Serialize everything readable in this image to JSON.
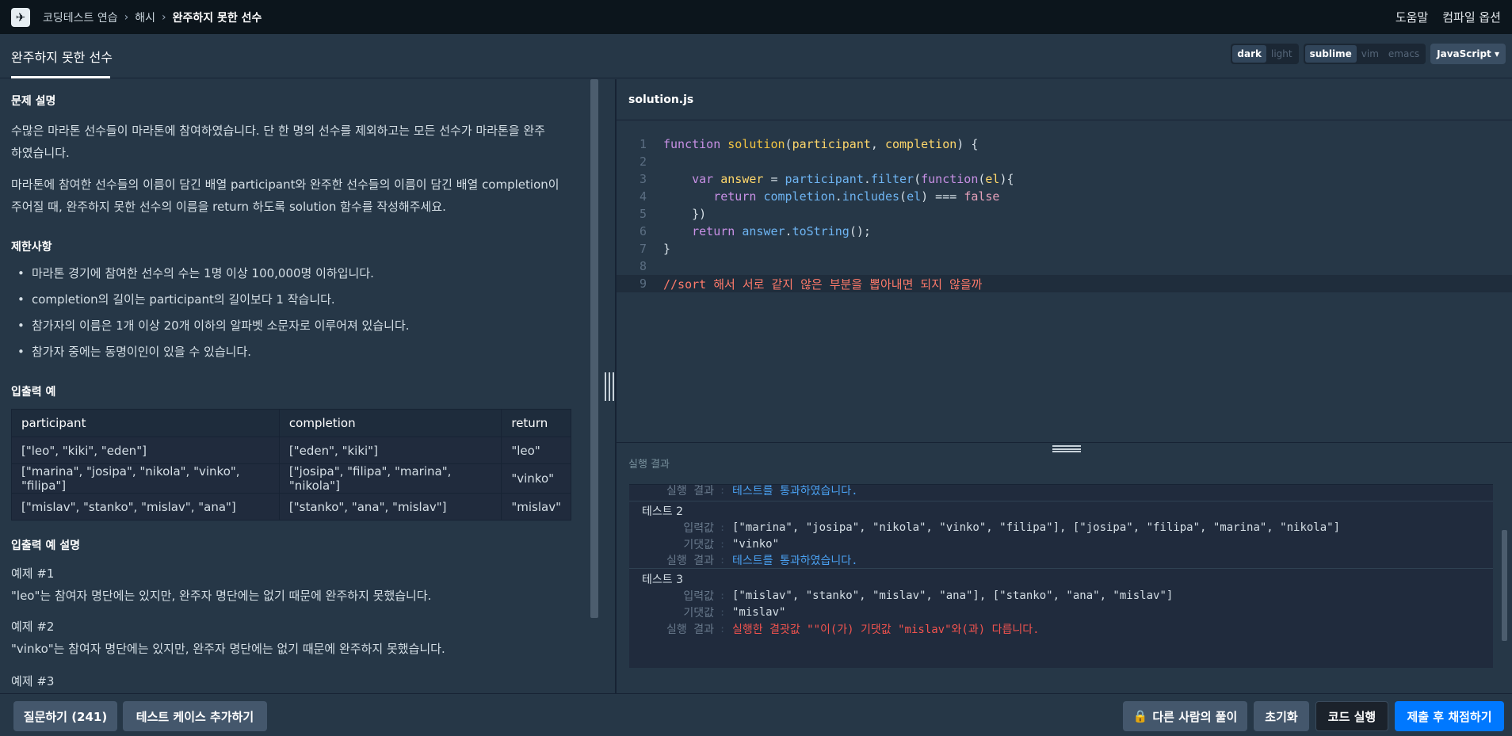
{
  "nav": {
    "crumbs": [
      "코딩테스트 연습",
      "해시",
      "완주하지 못한 선수"
    ],
    "help": "도움말",
    "compile_options": "컴파일 옵션"
  },
  "tab": {
    "title": "완주하지 못한 선수"
  },
  "settings": {
    "theme": [
      "dark",
      "light"
    ],
    "keymap": [
      "sublime",
      "vim",
      "emacs"
    ],
    "language": "JavaScript"
  },
  "problem": {
    "desc_heading": "문제 설명",
    "desc_p1a": "수많은 마라톤 선수들이 마라톤에 참여하였습니다. 단 한 명의 선수를 제외하고는 모든 선수가 마라톤을 완주",
    "desc_p1b": "하였습니다.",
    "desc_p2a": "마라톤에 참여한 선수들의 이름이 담긴 배열 participant와 완주한 선수들의 이름이 담긴 배열 completion이",
    "desc_p2b": "주어질 때, 완주하지 못한 선수의 이름을 return 하도록 solution 함수를 작성해주세요.",
    "limits_heading": "제한사항",
    "limits": [
      "마라톤 경기에 참여한 선수의 수는 1명 이상 100,000명 이하입니다.",
      "completion의 길이는 participant의 길이보다 1 작습니다.",
      "참가자의 이름은 1개 이상 20개 이하의 알파벳 소문자로 이루어져 있습니다.",
      "참가자 중에는 동명이인이 있을 수 있습니다."
    ],
    "io_heading": "입출력 예",
    "io_headers": [
      "participant",
      "completion",
      "return"
    ],
    "io_rows": [
      [
        "[\"leo\", \"kiki\", \"eden\"]",
        "[\"eden\", \"kiki\"]",
        "\"leo\""
      ],
      [
        "[\"marina\", \"josipa\", \"nikola\", \"vinko\", \"filipa\"]",
        "[\"josipa\", \"filipa\", \"marina\", \"nikola\"]",
        "\"vinko\""
      ],
      [
        "[\"mislav\", \"stanko\", \"mislav\", \"ana\"]",
        "[\"stanko\", \"ana\", \"mislav\"]",
        "\"mislav\""
      ]
    ],
    "io_desc_heading": "입출력 예 설명",
    "ex1_title": "예제 #1",
    "ex1_text": "\"leo\"는 참여자 명단에는 있지만, 완주자 명단에는 없기 때문에 완주하지 못했습니다.",
    "ex2_title": "예제 #2",
    "ex2_text": "\"vinko\"는 참여자 명단에는 있지만, 완주자 명단에는 없기 때문에 완주하지 못했습니다.",
    "ex3_title": "예제 #3"
  },
  "editor": {
    "filename": "solution.js",
    "line_numbers": [
      "1",
      "2",
      "3",
      "4",
      "5",
      "6",
      "7",
      "8",
      "9"
    ],
    "l1": {
      "kw": "function",
      "fn": "solution",
      "p1": "(",
      "a1": "participant",
      "c": ", ",
      "a2": "completion",
      "p2": ") {"
    },
    "l3": {
      "ind": "    ",
      "kw": "var",
      "sp": " ",
      "v": "answer",
      "eq": " = ",
      "o": "participant",
      "dot": ".",
      "m": "filter",
      "p": "(",
      "kw2": "function",
      "p2": "(",
      "a": "el",
      "p3": "){"
    },
    "l4": {
      "ind": "       ",
      "kw": "return",
      "sp": " ",
      "o": "completion",
      "dot": ".",
      "m": "includes",
      "p": "(",
      "a": "el",
      "p2": ") === ",
      "b": "false"
    },
    "l5": "    })",
    "l6": {
      "ind": "    ",
      "kw": "return",
      "sp": " ",
      "o": "answer",
      "dot": ".",
      "m": "toString",
      "p": "();"
    },
    "l7": "}",
    "l9": "//sort 해서 서로 같지 않은 부분을 뽑아내면 되지 않을까"
  },
  "results": {
    "title": "실행 결과",
    "label_result": "실행 결과",
    "label_input": "입력값",
    "label_expected": "기댓값",
    "pass_msg": "테스트를 통과하였습니다.",
    "test2_title": "테스트 2",
    "test2_input": "[\"marina\", \"josipa\", \"nikola\", \"vinko\", \"filipa\"], [\"josipa\", \"filipa\", \"marina\", \"nikola\"]",
    "test2_expected": "\"vinko\"",
    "test3_title": "테스트 3",
    "test3_input": "[\"mislav\", \"stanko\", \"mislav\", \"ana\"], [\"stanko\", \"ana\", \"mislav\"]",
    "test3_expected": "\"mislav\"",
    "test3_fail": "실행한 결괏값 \"\"이(가) 기댓값 \"mislav\"와(과) 다릅니다."
  },
  "bottom": {
    "ask": "질문하기 (241)",
    "add_tc": "테스트 케이스 추가하기",
    "others": "다른 사람의 풀이",
    "reset": "초기화",
    "run": "코드 실행",
    "submit": "제출 후 채점하기"
  }
}
